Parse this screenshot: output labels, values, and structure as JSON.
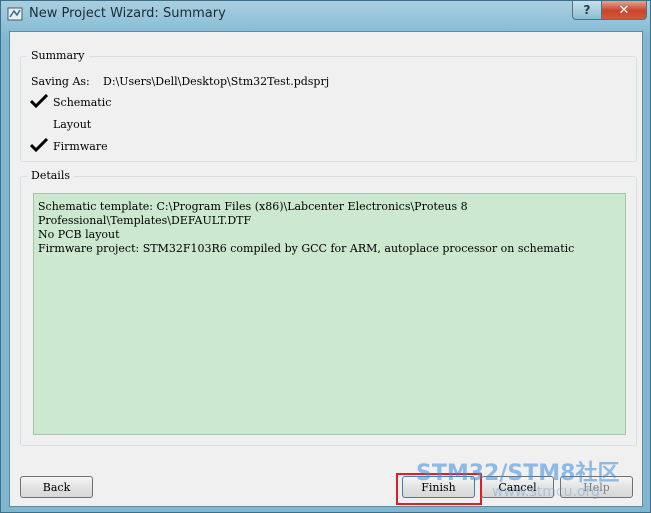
{
  "window": {
    "title": "New Project Wizard: Summary",
    "help_caption": "?",
    "close_caption": "✕"
  },
  "summary": {
    "label": "Summary",
    "saving_as_label": "Saving As:",
    "saving_as_value": "D:\\Users\\Dell\\Desktop\\Stm32Test.pdsprj",
    "items": [
      {
        "label": "Schematic",
        "checked": true
      },
      {
        "label": "Layout",
        "checked": false
      },
      {
        "label": "Firmware",
        "checked": true
      }
    ]
  },
  "details": {
    "label": "Details",
    "lines": [
      "Schematic template: C:\\Program Files (x86)\\Labcenter Electronics\\Proteus 8",
      "Professional\\Templates\\DEFAULT.DTF",
      "No PCB layout",
      "Firmware project: STM32F103R6 compiled by GCC for ARM, autoplace processor on schematic"
    ]
  },
  "buttons": {
    "back": "Back",
    "finish": "Finish",
    "cancel": "Cancel",
    "help": "Help"
  },
  "watermark": {
    "text": "STM32/STM8社区",
    "url": "www.stmcu.org"
  },
  "colors": {
    "details_background": "#cce8cf",
    "highlight_border": "#e02020"
  }
}
